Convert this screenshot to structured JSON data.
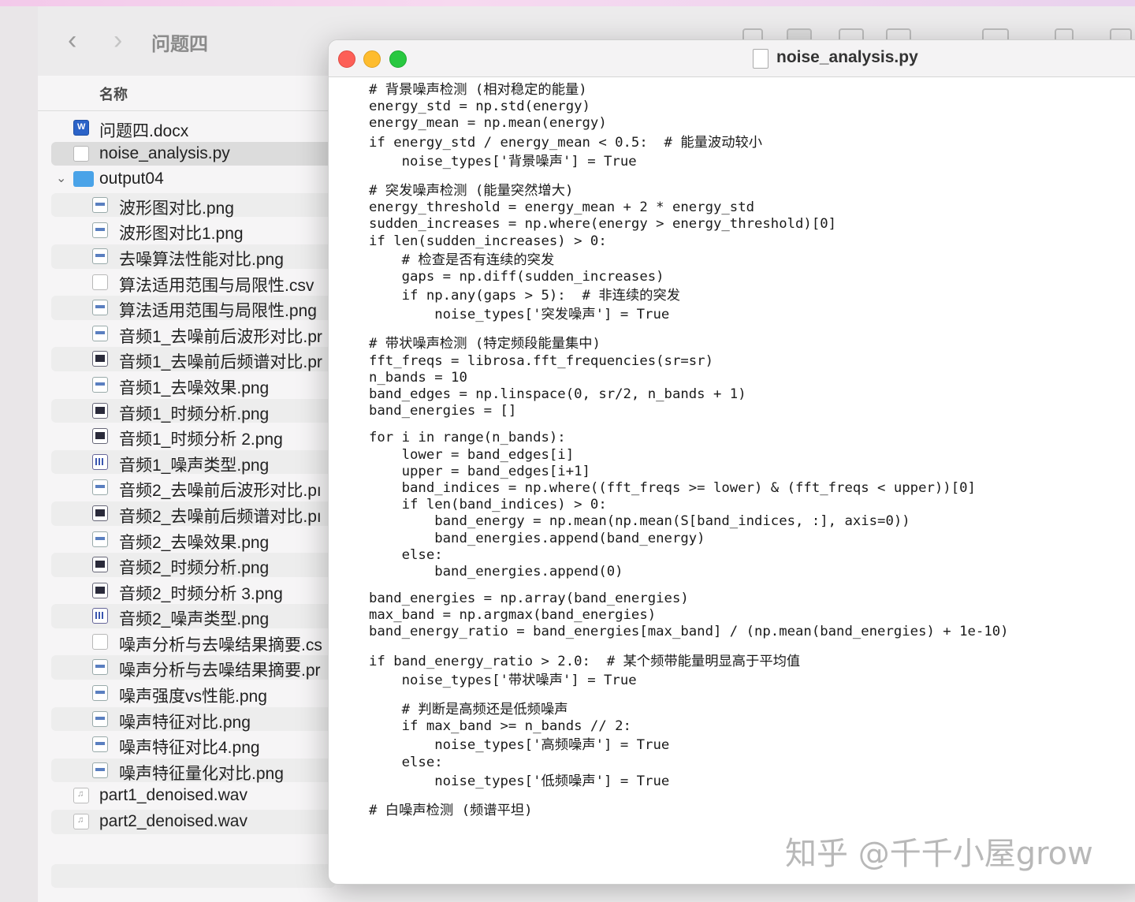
{
  "finder": {
    "folder_title": "问题四",
    "column_header": "名称",
    "files": [
      {
        "name": "问题四.docx",
        "icon": "word-doc-icon",
        "level": 0
      },
      {
        "name": "noise_analysis.py",
        "icon": "python-file-icon",
        "level": 0,
        "selected": true
      },
      {
        "name": "output04",
        "icon": "folder-icon",
        "level": 0,
        "expanded": true
      },
      {
        "name": "波形图对比.png",
        "icon": "image-file-icon",
        "level": 1
      },
      {
        "name": "波形图对比1.png",
        "icon": "image-file-icon",
        "level": 1
      },
      {
        "name": "去噪算法性能对比.png",
        "icon": "image-file-icon",
        "level": 1
      },
      {
        "name": "算法适用范围与局限性.csv",
        "icon": "csv-file-icon",
        "level": 1
      },
      {
        "name": "算法适用范围与局限性.png",
        "icon": "image-file-icon",
        "level": 1
      },
      {
        "name": "音频1_去噪前后波形对比.pr",
        "icon": "image-file-icon",
        "level": 1
      },
      {
        "name": "音频1_去噪前后频谱对比.pr",
        "icon": "spectrum-image-icon",
        "level": 1
      },
      {
        "name": "音频1_去噪效果.png",
        "icon": "image-file-icon",
        "level": 1
      },
      {
        "name": "音频1_时频分析.png",
        "icon": "spectrum-image-icon",
        "level": 1
      },
      {
        "name": "音频1_时频分析 2.png",
        "icon": "spectrum-image-icon",
        "level": 1
      },
      {
        "name": "音频1_噪声类型.png",
        "icon": "bar-chart-image-icon",
        "level": 1
      },
      {
        "name": "音频2_去噪前后波形对比.pı",
        "icon": "image-file-icon",
        "level": 1
      },
      {
        "name": "音频2_去噪前后频谱对比.pı",
        "icon": "spectrum-image-icon",
        "level": 1
      },
      {
        "name": "音频2_去噪效果.png",
        "icon": "image-file-icon",
        "level": 1
      },
      {
        "name": "音频2_时频分析.png",
        "icon": "spectrum-image-icon",
        "level": 1
      },
      {
        "name": "音频2_时频分析 3.png",
        "icon": "spectrum-image-icon",
        "level": 1
      },
      {
        "name": "音频2_噪声类型.png",
        "icon": "bar-chart-image-icon",
        "level": 1
      },
      {
        "name": "噪声分析与去噪结果摘要.cs",
        "icon": "csv-file-icon",
        "level": 1
      },
      {
        "name": "噪声分析与去噪结果摘要.pr",
        "icon": "image-file-icon",
        "level": 1
      },
      {
        "name": "噪声强度vs性能.png",
        "icon": "image-file-icon",
        "level": 1
      },
      {
        "name": "噪声特征对比.png",
        "icon": "image-file-icon",
        "level": 1
      },
      {
        "name": "噪声特征对比4.png",
        "icon": "image-file-icon",
        "level": 1
      },
      {
        "name": "噪声特征量化对比.png",
        "icon": "image-file-icon",
        "level": 1
      },
      {
        "name": "part1_denoised.wav",
        "icon": "audio-file-icon",
        "level": 0
      },
      {
        "name": "part2_denoised.wav",
        "icon": "audio-file-icon",
        "level": 0
      }
    ]
  },
  "editor": {
    "title": "noise_analysis.py",
    "code_lines": [
      "# 背景噪声检测 (相对稳定的能量)",
      "energy_std = np.std(energy)",
      "energy_mean = np.mean(energy)",
      "if energy_std / energy_mean < 0.5:  # 能量波动较小",
      "    noise_types['背景噪声'] = True",
      "",
      "# 突发噪声检测 (能量突然增大)",
      "energy_threshold = energy_mean + 2 * energy_std",
      "sudden_increases = np.where(energy > energy_threshold)[0]",
      "if len(sudden_increases) > 0:",
      "    # 检查是否有连续的突发",
      "    gaps = np.diff(sudden_increases)",
      "    if np.any(gaps > 5):  # 非连续的突发",
      "        noise_types['突发噪声'] = True",
      "",
      "# 带状噪声检测 (特定频段能量集中)",
      "fft_freqs = librosa.fft_frequencies(sr=sr)",
      "n_bands = 10",
      "band_edges = np.linspace(0, sr/2, n_bands + 1)",
      "band_energies = []",
      "",
      "for i in range(n_bands):",
      "    lower = band_edges[i]",
      "    upper = band_edges[i+1]",
      "    band_indices = np.where((fft_freqs >= lower) & (fft_freqs < upper))[0]",
      "    if len(band_indices) > 0:",
      "        band_energy = np.mean(np.mean(S[band_indices, :], axis=0))",
      "        band_energies.append(band_energy)",
      "    else:",
      "        band_energies.append(0)",
      "",
      "band_energies = np.array(band_energies)",
      "max_band = np.argmax(band_energies)",
      "band_energy_ratio = band_energies[max_band] / (np.mean(band_energies) + 1e-10)",
      "",
      "if band_energy_ratio > 2.0:  # 某个频带能量明显高于平均值",
      "    noise_types['带状噪声'] = True",
      "",
      "    # 判断是高频还是低频噪声",
      "    if max_band >= n_bands // 2:",
      "        noise_types['高频噪声'] = True",
      "    else:",
      "        noise_types['低频噪声'] = True",
      "",
      "# 白噪声检测 (频谱平坦)"
    ]
  },
  "watermark": "知乎 @千千小屋grow"
}
